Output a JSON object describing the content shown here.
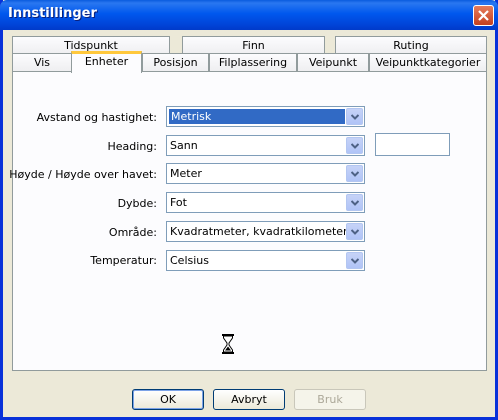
{
  "window": {
    "title": "Innstillinger"
  },
  "tabs_row1": [
    "Tidspunkt",
    "Finn",
    "Ruting"
  ],
  "tabs_row2": [
    "Vis",
    "Enheter",
    "Posisjon",
    "Filplassering",
    "Veipunkt",
    "Veipunktkategorier"
  ],
  "active_tab": "Enheter",
  "fields": {
    "distance": {
      "label": "Avstand og hastighet:",
      "value": "Metrisk"
    },
    "heading": {
      "label": "Heading:",
      "value": "Sann"
    },
    "altitude": {
      "label": "Høyde / Høyde over havet:",
      "value": "Meter"
    },
    "depth": {
      "label": "Dybde:",
      "value": "Fot"
    },
    "area": {
      "label": "Område:",
      "value": "Kvadratmeter, kvadratkilometer"
    },
    "temperature": {
      "label": "Temperatur:",
      "value": "Celsius"
    }
  },
  "heading_extra_value": "",
  "buttons": {
    "ok": "OK",
    "cancel": "Avbryt",
    "apply": "Bruk"
  },
  "icons": {
    "close": "close-icon",
    "dropdown": "chevron-down-icon",
    "busy": "hourglass-icon"
  }
}
